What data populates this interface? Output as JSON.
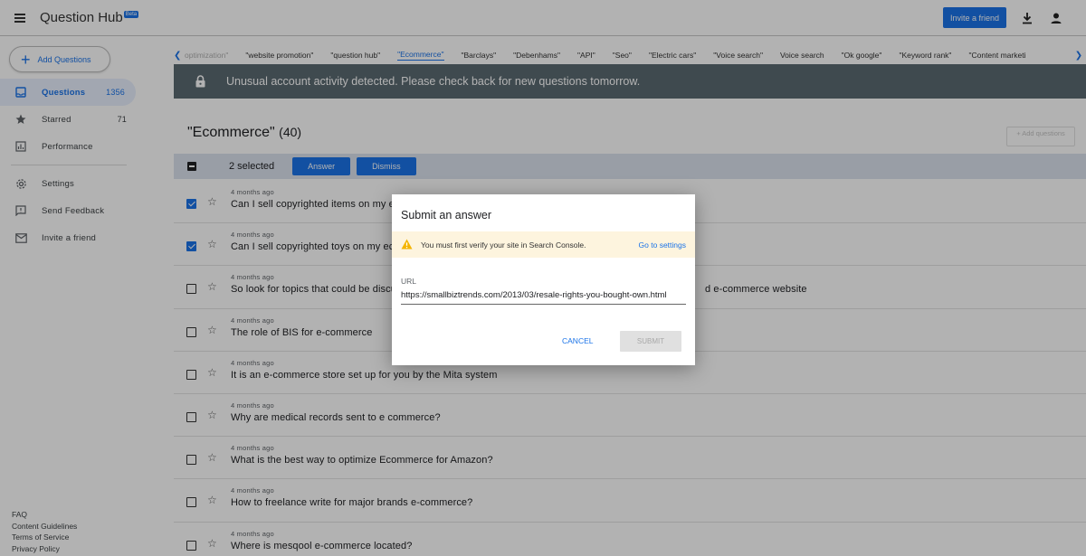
{
  "app": {
    "title": "Question Hub",
    "badge": "Beta"
  },
  "header": {
    "invite_label": "Invite a friend"
  },
  "sidebar": {
    "add_label": "Add Questions",
    "items": [
      {
        "label": "Questions",
        "count": "1356"
      },
      {
        "label": "Starred",
        "count": "71"
      },
      {
        "label": "Performance",
        "count": ""
      },
      {
        "label": "Settings"
      },
      {
        "label": "Send Feedback"
      },
      {
        "label": "Invite a friend"
      }
    ],
    "footer": [
      "FAQ",
      "Content Guidelines",
      "Terms of Service",
      "Privacy Policy"
    ]
  },
  "tags": [
    "optimization\"",
    "\"website promotion\"",
    "\"question hub\"",
    "\"Ecommerce\"",
    "\"Barclays\"",
    "\"Debenhams\"",
    "\"API\"",
    "\"Seo\"",
    "\"Electric cars\"",
    "\"Voice search\"",
    "Voice search",
    "\"Ok google\"",
    "\"Keyword rank\"",
    "\"Content marketi"
  ],
  "alert": {
    "text": "Unusual account activity detected. Please check back for new questions tomorrow."
  },
  "main": {
    "title": "\"Ecommerce\"",
    "count": "(40)",
    "add_small": "+ Add questions",
    "selected": "2 selected",
    "answer_btn": "Answer",
    "dismiss_btn": "Dismiss"
  },
  "questions": [
    {
      "time": "4 months ago",
      "text": "Can I sell copyrighted items on my e",
      "checked": true
    },
    {
      "time": "4 months ago",
      "text": "Can I sell copyrighted toys on my ec",
      "checked": true
    },
    {
      "time": "4 months ago",
      "text": "So look for topics that could be discu",
      "tail": "d e-commerce website",
      "checked": false
    },
    {
      "time": "4 months ago",
      "text": "The role of BIS for e-commerce",
      "checked": false
    },
    {
      "time": "4 months ago",
      "text": "It is an e-commerce store set up for you by the Mita system",
      "checked": false
    },
    {
      "time": "4 months ago",
      "text": "Why are medical records sent to e commerce?",
      "checked": false
    },
    {
      "time": "4 months ago",
      "text": "What is the best way to optimize Ecommerce for Amazon?",
      "checked": false
    },
    {
      "time": "4 months ago",
      "text": "How to freelance write for major brands e-commerce?",
      "checked": false
    },
    {
      "time": "4 months ago",
      "text": "Where is mesqool e-commerce located?",
      "checked": false
    }
  ],
  "dialog": {
    "title": "Submit an answer",
    "warning": "You must first verify your site in Search Console.",
    "goto": "Go to settings",
    "url_label": "URL",
    "url_value": "https://smallbiztrends.com/2013/03/resale-rights-you-bought-own.html",
    "cancel": "CANCEL",
    "submit": "SUBMIT"
  },
  "colors": {
    "accent": "#1a73e8",
    "alert_bg": "#5b6a72",
    "selection_bg": "#dce3ee",
    "warning_bg": "#fdf4de",
    "warning_icon": "#f4b400"
  }
}
